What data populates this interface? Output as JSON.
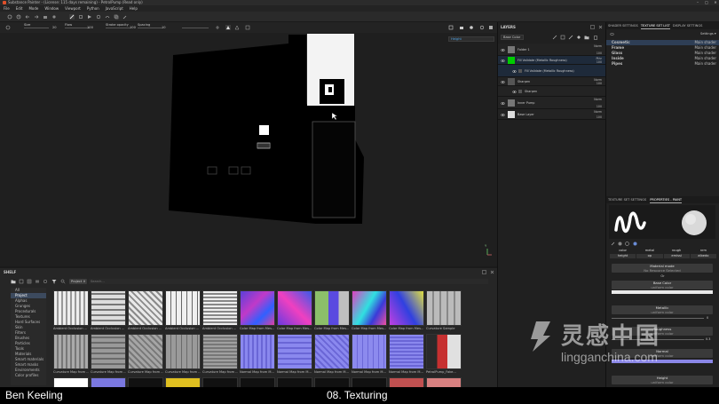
{
  "window": {
    "title": "Substance Painter - (License: 115 days remaining) - PetrolPump (Read only)",
    "controls": [
      "–",
      "□",
      "✕"
    ]
  },
  "menu": [
    "File",
    "Edit",
    "Mode",
    "Window",
    "Viewport",
    "Python",
    "JavaScript",
    "Help"
  ],
  "properties_bar": {
    "size_label": "Size",
    "size_value": "20",
    "flow_label": "Flow",
    "flow_value": "100",
    "stroke_opacity_label": "Stroke opacity",
    "stroke_opacity_value": "100",
    "spacing_label": "Spacing",
    "spacing_value": "10"
  },
  "viewport": {
    "channel_dropdown": "Height",
    "axis_label": "Y"
  },
  "layers": {
    "title": "LAYERS",
    "blend_dropdown": "Base Color",
    "items": [
      {
        "name": "Folder 1",
        "blend": "Norm",
        "opacity": "100"
      },
      {
        "name": "Fill Validate (Metallic Roughness)",
        "blend": "Pthr",
        "opacity": "100"
      },
      {
        "name": "Fill Validate (Metallic Roughness)",
        "blend": "",
        "opacity": ""
      },
      {
        "name": "Sharpen",
        "blend": "Norm",
        "opacity": "100"
      },
      {
        "name": "Sharpen",
        "blend": "",
        "opacity": ""
      },
      {
        "name": "Inner Pump",
        "blend": "Norm",
        "opacity": "100"
      },
      {
        "name": "Base Layer",
        "blend": "Norm",
        "opacity": "100"
      }
    ]
  },
  "texture_set_list": {
    "tabs": [
      "SHADER SETTINGS",
      "TEXTURE SET LIST",
      "DISPLAY SETTINGS"
    ],
    "settings_label": "Settings ▾",
    "rows": [
      {
        "name": "Cosmetic",
        "shader": "Main shader"
      },
      {
        "name": "Frame",
        "shader": "Main shader"
      },
      {
        "name": "Glass",
        "shader": "Main shader"
      },
      {
        "name": "Inside",
        "shader": "Main shader"
      },
      {
        "name": "Pipes",
        "shader": "Main shader"
      }
    ]
  },
  "properties_paint": {
    "tabs": [
      "TEXTURE SET SETTINGS",
      "PROPERTIES - PAINT"
    ],
    "channels_row1": [
      "color",
      "metal",
      "rough",
      "nrm"
    ],
    "channels_row2": [
      "height",
      "op",
      "emissi",
      "albedo"
    ],
    "material_mode_label": "Material mode",
    "material_mode_value": "No Resource Selected",
    "or_label": "Or",
    "base_color_label": "Base Color",
    "base_color_value": "uniform color",
    "metallic_label": "Metallic",
    "metallic_value": "uniform color",
    "metallic_slider": "0",
    "roughness_label": "Roughness",
    "roughness_value": "uniform color",
    "roughness_slider": "0.3",
    "normal_label": "Normal",
    "normal_value": "uniform color",
    "height_label": "Height",
    "height_value": "uniform color"
  },
  "shelf": {
    "title": "SHELF",
    "filter_tag": "Project",
    "search_placeholder": "Search...",
    "categories": [
      "All",
      "Project",
      "Alphas",
      "Grunges",
      "Procedurals",
      "Textures",
      "Hard Surfaces",
      "Skin",
      "Filters",
      "Brushes",
      "Particles",
      "Tools",
      "Materials",
      "Smart materials",
      "Smart masks",
      "Environments",
      "Color profiles"
    ],
    "items_row1": [
      "Ambient Occlusion ...",
      "Ambient Occlusion ...",
      "Ambient Occlusion ...",
      "Ambient Occlusion ...",
      "Ambient Occlusion ...",
      "Color Map from Mes...",
      "Color Map from Mes...",
      "Color Map from Mes...",
      "Color Map from Mes...",
      "Color Map from Mes...",
      "Curvature Sample"
    ],
    "items_row2": [
      "Curvature Map from ...",
      "Curvature Map from ...",
      "Curvature Map from ...",
      "Curvature Map from ...",
      "Curvature Map from ...",
      "Normal Map from M...",
      "Normal Map from M...",
      "Normal Map from M...",
      "Normal Map from M...",
      "Normal Map from M...",
      "PetrolPump_Fake..."
    ]
  },
  "caption": {
    "left": "Ben Keeling",
    "center": "08. Texturing"
  },
  "watermark": {
    "name": "灵感中国",
    "url": "lingganchina.com"
  }
}
